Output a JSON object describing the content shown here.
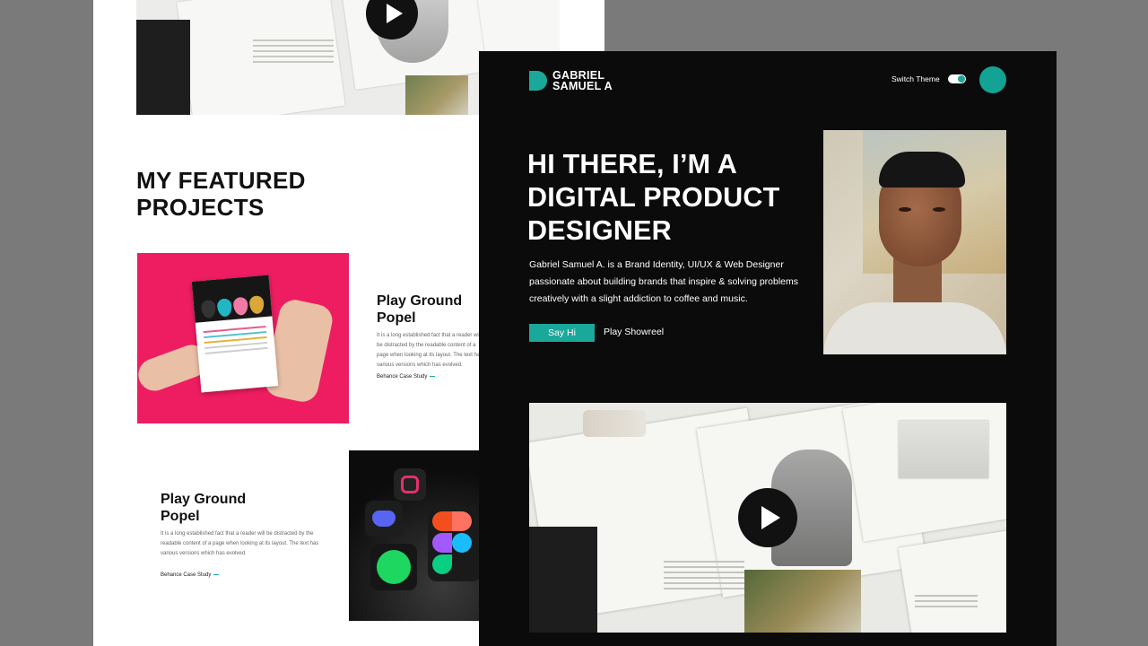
{
  "light_page": {
    "featured_title_line1": "MY FEATURED",
    "featured_title_line2": "PROJECTS",
    "projects": [
      {
        "title_line1": "Play Ground",
        "title_line2": "Popel",
        "description": "It is a long established fact that a reader will be distracted by the readable content of a page when looking at its layout. The text has various versions which has evolved.",
        "link": "Behance Case Study"
      },
      {
        "title_line1": "Play Ground",
        "title_line2": "Popel",
        "description": "It is a long established fact that a reader will be distracted by the readable content of a page when looking at its layout. The text has various versions which has evolved.",
        "link": "Behance Case Study"
      }
    ]
  },
  "dark_page": {
    "logo_line1": "GABRIEL",
    "logo_line2": "SAMUEL A",
    "switch_theme_label": "Switch Theme",
    "hero_line1": "HI THERE, I’M A",
    "hero_line2": "DIGITAL PRODUCT",
    "hero_line3": "DESIGNER",
    "hero_description": "Gabriel Samuel A. is a Brand Identity, UI/UX & Web Designer passionate about building brands that inspire & solving problems creatively with a slight addiction to coffee and music.",
    "say_hi_label": "Say Hi",
    "play_showreel_label": "Play Showreel"
  },
  "colors": {
    "accent": "#1aa89a",
    "dark_bg": "#0b0b0b",
    "backdrop": "#7a7a7a",
    "project1_bg": "#ee1d61"
  },
  "icons": [
    "play-icon",
    "logo-mark-icon",
    "theme-toggle",
    "instagram-icon",
    "discord-icon",
    "spotify-icon",
    "figma-icon"
  ]
}
